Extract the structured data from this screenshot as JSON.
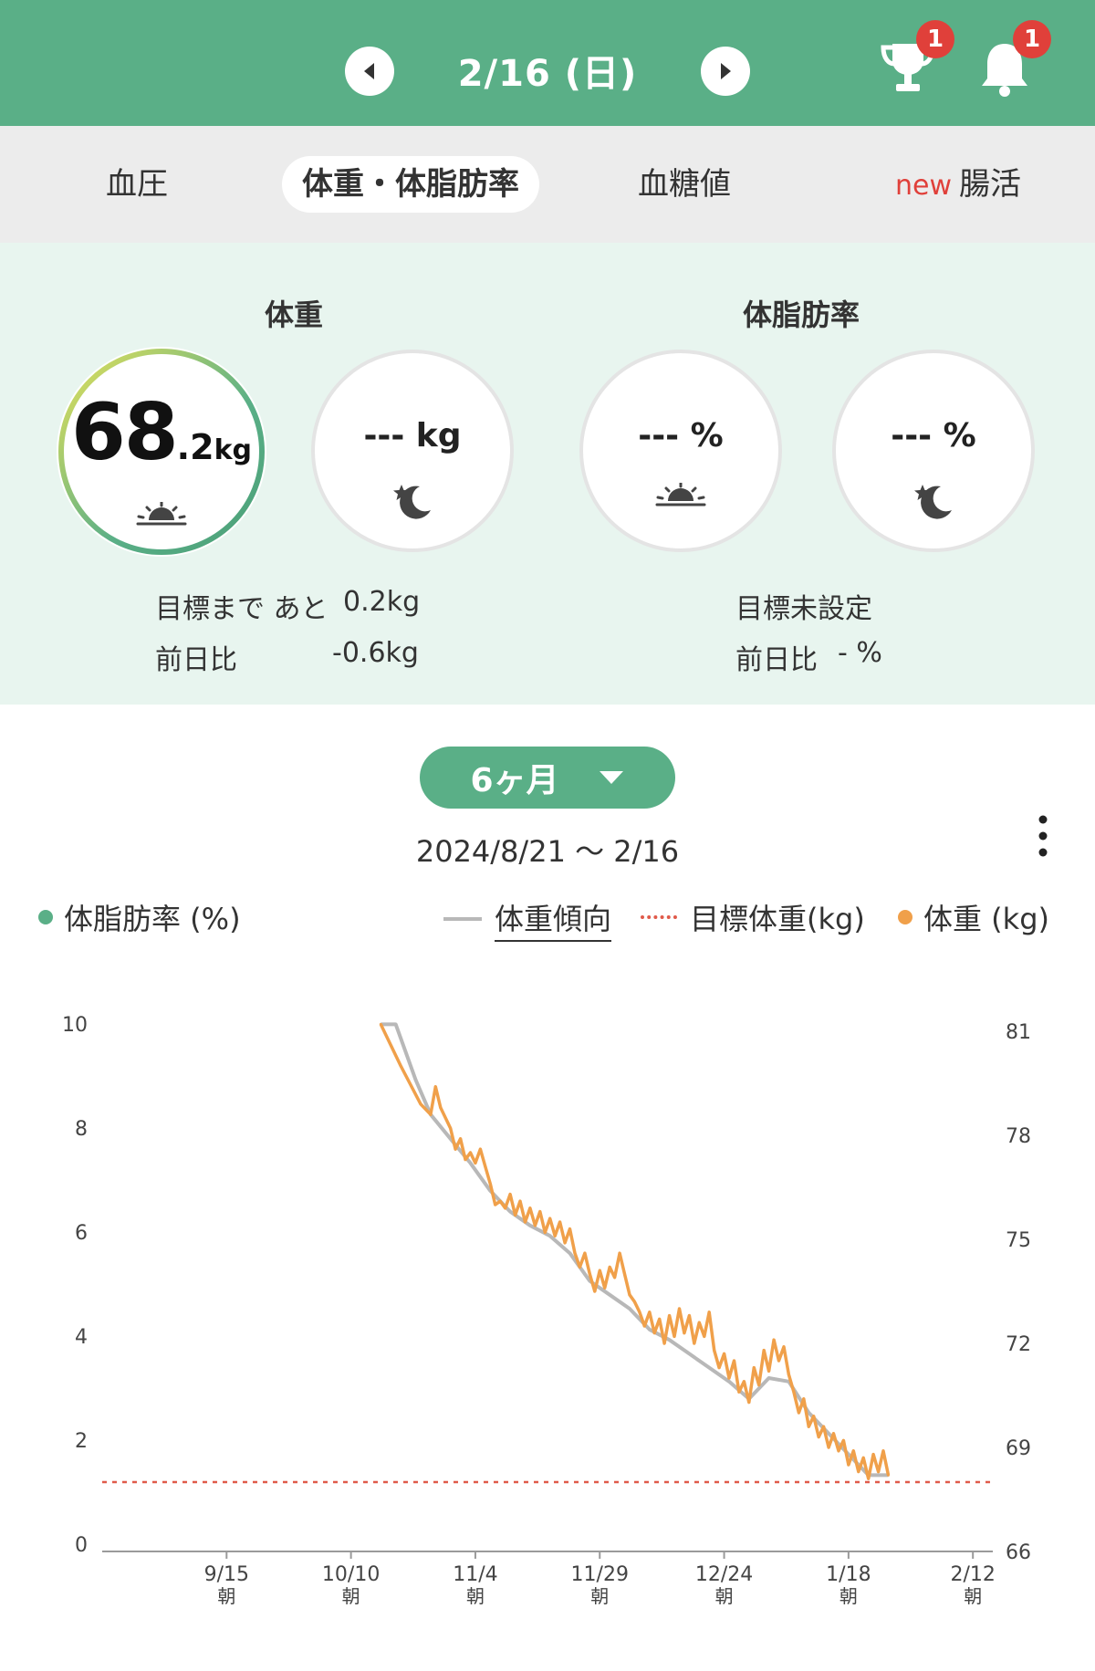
{
  "header": {
    "date": "2/16 (日)",
    "trophy_badge": "1",
    "bell_badge": "1",
    "icons": [
      "prev-arrow-icon",
      "next-arrow-icon",
      "trophy-icon",
      "bell-icon"
    ]
  },
  "tabs": [
    {
      "label": "血圧"
    },
    {
      "label": "体重・体脂肪率",
      "active": true
    },
    {
      "label": "血糖値"
    },
    {
      "new": "new",
      "label": "腸活"
    }
  ],
  "weight": {
    "title": "体重",
    "morning_int": "68",
    "morning_dec": ".2",
    "unit": "kg",
    "evening": "--- kg",
    "goal_label": "目標まで あと",
    "goal_value": "0.2kg",
    "diff_label": "前日比",
    "diff_value": "-0.6kg",
    "ring_colors": [
      "#e6e25a",
      "#5aaf87"
    ]
  },
  "body_fat": {
    "title": "体脂肪率",
    "morning": "--- %",
    "evening": "--- %",
    "goal_label": "目標未設定",
    "diff_label": "前日比",
    "diff_value": "- %"
  },
  "period": {
    "label": "6ヶ月",
    "range": "2024/8/21 ～ 2/16"
  },
  "legend": {
    "body_fat": "体脂肪率 (%)",
    "trend": "体重傾向",
    "target": "目標体重(kg)",
    "weight": "体重 (kg)"
  },
  "chart_data": {
    "type": "line",
    "x_ticks": [
      {
        "date": "9/15",
        "sub": "朝"
      },
      {
        "date": "10/10",
        "sub": "朝"
      },
      {
        "date": "11/4",
        "sub": "朝"
      },
      {
        "date": "11/29",
        "sub": "朝"
      },
      {
        "date": "12/24",
        "sub": "朝"
      },
      {
        "date": "1/18",
        "sub": "朝"
      },
      {
        "date": "2/12",
        "sub": "朝"
      }
    ],
    "x_range_days": [
      0,
      179
    ],
    "x_tick_days": [
      25,
      50,
      75,
      100,
      125,
      150,
      175
    ],
    "y_left_ticks": [
      "10",
      "8",
      "6",
      "4",
      "2",
      "0"
    ],
    "y_left_range": [
      0,
      10
    ],
    "y_right_ticks": [
      "81",
      "78",
      "75",
      "72",
      "69",
      "66"
    ],
    "y_right_range": [
      66,
      81
    ],
    "target_weight": 68.0,
    "weight_points": [
      [
        56,
        81.2
      ],
      [
        60,
        80.0
      ],
      [
        64,
        78.9
      ],
      [
        66,
        78.6
      ],
      [
        67,
        79.4
      ],
      [
        68,
        78.8
      ],
      [
        70,
        78.2
      ],
      [
        71,
        77.6
      ],
      [
        72,
        77.9
      ],
      [
        73,
        77.3
      ],
      [
        74,
        77.5
      ],
      [
        75,
        77.2
      ],
      [
        76,
        77.6
      ],
      [
        77,
        77.1
      ],
      [
        78,
        76.6
      ],
      [
        79,
        76.0
      ],
      [
        80,
        76.1
      ],
      [
        81,
        75.9
      ],
      [
        82,
        76.3
      ],
      [
        83,
        75.7
      ],
      [
        84,
        76.1
      ],
      [
        85,
        75.5
      ],
      [
        86,
        75.9
      ],
      [
        87,
        75.4
      ],
      [
        88,
        75.8
      ],
      [
        89,
        75.2
      ],
      [
        90,
        75.6
      ],
      [
        91,
        75.1
      ],
      [
        92,
        75.5
      ],
      [
        93,
        74.9
      ],
      [
        94,
        75.3
      ],
      [
        95,
        74.6
      ],
      [
        96,
        74.2
      ],
      [
        97,
        74.6
      ],
      [
        98,
        74.0
      ],
      [
        99,
        73.5
      ],
      [
        100,
        74.1
      ],
      [
        101,
        73.6
      ],
      [
        102,
        74.2
      ],
      [
        103,
        73.9
      ],
      [
        104,
        74.6
      ],
      [
        105,
        74.0
      ],
      [
        106,
        73.4
      ],
      [
        107,
        73.2
      ],
      [
        108,
        72.9
      ],
      [
        109,
        72.5
      ],
      [
        110,
        72.9
      ],
      [
        111,
        72.3
      ],
      [
        112,
        72.7
      ],
      [
        113,
        72.0
      ],
      [
        114,
        72.8
      ],
      [
        115,
        72.2
      ],
      [
        116,
        73.0
      ],
      [
        117,
        72.3
      ],
      [
        118,
        72.8
      ],
      [
        119,
        72.0
      ],
      [
        120,
        72.6
      ],
      [
        121,
        72.2
      ],
      [
        122,
        72.9
      ],
      [
        123,
        71.8
      ],
      [
        124,
        71.3
      ],
      [
        125,
        71.7
      ],
      [
        126,
        71.0
      ],
      [
        127,
        71.5
      ],
      [
        128,
        70.6
      ],
      [
        129,
        70.9
      ],
      [
        130,
        70.3
      ],
      [
        131,
        71.3
      ],
      [
        132,
        70.8
      ],
      [
        133,
        71.8
      ],
      [
        134,
        71.2
      ],
      [
        135,
        72.1
      ],
      [
        136,
        71.5
      ],
      [
        137,
        71.9
      ],
      [
        138,
        71.1
      ],
      [
        139,
        70.6
      ],
      [
        140,
        70.0
      ],
      [
        141,
        70.4
      ],
      [
        142,
        69.6
      ],
      [
        143,
        69.9
      ],
      [
        144,
        69.3
      ],
      [
        145,
        69.6
      ],
      [
        146,
        69.0
      ],
      [
        147,
        69.4
      ],
      [
        148,
        68.9
      ],
      [
        149,
        69.2
      ],
      [
        150,
        68.5
      ],
      [
        151,
        68.9
      ],
      [
        152,
        68.3
      ],
      [
        153,
        68.7
      ],
      [
        154,
        68.1
      ],
      [
        155,
        68.8
      ],
      [
        156,
        68.3
      ],
      [
        157,
        68.9
      ],
      [
        158,
        68.2
      ]
    ],
    "trend_points": [
      [
        56,
        81.2
      ],
      [
        59,
        81.2
      ],
      [
        63,
        79.6
      ],
      [
        66,
        78.6
      ],
      [
        70,
        77.9
      ],
      [
        74,
        77.2
      ],
      [
        78,
        76.4
      ],
      [
        82,
        75.8
      ],
      [
        86,
        75.4
      ],
      [
        90,
        75.1
      ],
      [
        94,
        74.6
      ],
      [
        98,
        73.8
      ],
      [
        102,
        73.4
      ],
      [
        106,
        73.0
      ],
      [
        110,
        72.4
      ],
      [
        114,
        72.1
      ],
      [
        118,
        71.7
      ],
      [
        122,
        71.3
      ],
      [
        126,
        70.9
      ],
      [
        130,
        70.4
      ],
      [
        134,
        71.0
      ],
      [
        138,
        70.9
      ],
      [
        142,
        70.0
      ],
      [
        146,
        69.4
      ],
      [
        150,
        68.8
      ],
      [
        154,
        68.2
      ],
      [
        158,
        68.2
      ]
    ],
    "colors": {
      "weight": "#f0a04a",
      "trend": "#b8b8b8",
      "target": "#e05a4a",
      "body_fat": "#5aaf87"
    }
  }
}
